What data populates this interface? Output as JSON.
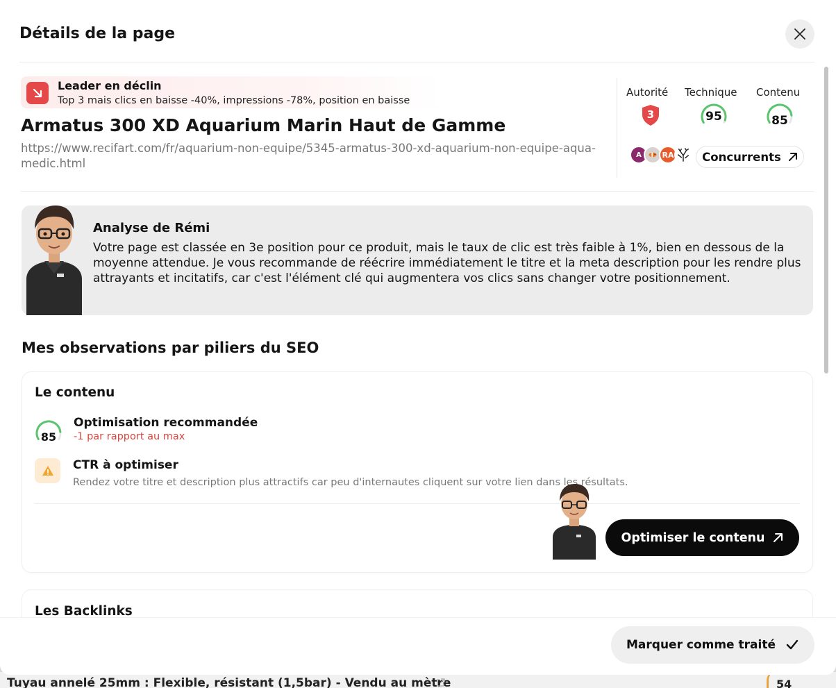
{
  "modal": {
    "title": "Détails de la page"
  },
  "status": {
    "title": "Leader en déclin",
    "description": "Top 3 mais clics en baisse -40%, impressions -78%, position en baisse",
    "color": "#e54848"
  },
  "page": {
    "heading": "Armatus 300 XD Aquarium Marin Haut de Gamme",
    "url": "https://www.recifart.com/fr/aquarium-non-equipe/5345-armatus-300-xd-aquarium-non-equipe-aqua-medic.html"
  },
  "scores": {
    "authority": {
      "label": "Autorité",
      "value": "3",
      "icon": "shield-icon",
      "color": "#e54848"
    },
    "technical": {
      "label": "Technique",
      "value": "95",
      "fraction": 0.95,
      "color": "#5cc46f"
    },
    "content": {
      "label": "Contenu",
      "value": "85",
      "fraction": 0.85,
      "color": "#5cc46f"
    }
  },
  "competitors": {
    "button_label": "Concurrents",
    "avatars": [
      {
        "initials": "A",
        "color": "#8a2a6a"
      },
      {
        "initials": "",
        "color": "#c9c9c9"
      },
      {
        "initials": "RA",
        "color": "#e85b2a"
      },
      {
        "initials": "",
        "color": "#ffffff"
      }
    ]
  },
  "analysis": {
    "title": "Analyse de Rémi",
    "text": "Votre page est classée en 3e position pour ce produit, mais le taux de clic est très faible à 1%, bien en dessous de la moyenne attendue. Je vous recommande de réécrire immédiatement le titre et la meta description pour les rendre plus attrayants et incitatifs, car c'est l'élément clé qui augmentera vos clics sans changer votre positionnement."
  },
  "observations": {
    "title": "Mes observations par piliers du SEO"
  },
  "content_pillar": {
    "title": "Le contenu",
    "score": "85",
    "score_fraction": 0.85,
    "optimisation_title": "Optimisation recommandée",
    "optimisation_sub": "-1 par rapport au max",
    "ctr_title": "CTR à optimiser",
    "ctr_desc": "Rendez votre titre et description plus attractifs car peu d'internautes cliquent sur votre lien dans les résultats.",
    "button_label": "Optimiser le contenu"
  },
  "backlinks_pillar": {
    "title": "Les Backlinks"
  },
  "footer": {
    "mark_label": "Marquer comme traité"
  },
  "background_row": {
    "text": "Tuyau annelé 25mm : Flexible, résistant (1,5bar) - Vendu au mètre",
    "score": "54"
  }
}
